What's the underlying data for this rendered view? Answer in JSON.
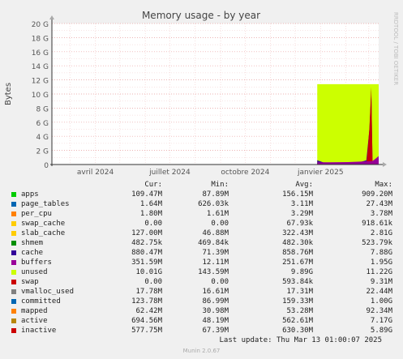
{
  "chart_data": {
    "type": "area",
    "title": "Memory usage - by year",
    "ylabel": "Bytes",
    "watermark": "RRDTOOL / TOBI OETIKER",
    "y_ticks": [
      "0",
      "2 G",
      "4 G",
      "6 G",
      "8 G",
      "10 G",
      "12 G",
      "14 G",
      "16 G",
      "18 G",
      "20 G"
    ],
    "ylim": [
      0,
      20
    ],
    "y_unit": "GB",
    "x_ticks": [
      {
        "label": "avril 2024",
        "date": "2024-04-01"
      },
      {
        "label": "juillet 2024",
        "date": "2024-07-01"
      },
      {
        "label": "octobre 2024",
        "date": "2024-10-01"
      },
      {
        "label": "janvier 2025",
        "date": "2025-01-01"
      }
    ],
    "xlim": [
      "2024-02-08",
      "2025-03-13"
    ],
    "data_start": "2024-12-28",
    "series_colors": {
      "unused": "#CCFF00",
      "apps": "#00CC00",
      "cache": "#330099",
      "swap": "#CC0000",
      "buffers": "#990099",
      "committed": "#0066B3"
    },
    "series": [
      {
        "name": "apps",
        "points": [
          [
            0.0,
            0.15
          ],
          [
            0.2,
            0.12
          ],
          [
            0.4,
            0.1
          ],
          [
            0.6,
            0.12
          ],
          [
            0.8,
            0.1
          ],
          [
            1.0,
            0.11
          ]
        ]
      },
      {
        "name": "cache",
        "points": [
          [
            0.0,
            0.6
          ],
          [
            0.1,
            0.3
          ],
          [
            0.3,
            0.25
          ],
          [
            0.5,
            0.3
          ],
          [
            0.7,
            0.35
          ],
          [
            0.8,
            0.6
          ],
          [
            0.85,
            5.0
          ],
          [
            0.88,
            10.5
          ],
          [
            0.9,
            0.5
          ],
          [
            1.0,
            0.88
          ]
        ]
      },
      {
        "name": "swap",
        "points": [
          [
            0.0,
            0.0
          ],
          [
            0.8,
            0.0
          ],
          [
            0.82,
            2.0
          ],
          [
            0.85,
            5.2
          ],
          [
            0.88,
            11.0
          ],
          [
            0.9,
            0.3
          ],
          [
            1.0,
            0.0
          ]
        ]
      },
      {
        "name": "buffers",
        "points": [
          [
            0.0,
            0.3
          ],
          [
            0.5,
            0.35
          ],
          [
            0.9,
            0.5
          ],
          [
            1.0,
            1.2
          ]
        ]
      },
      {
        "name": "unused",
        "points": [
          [
            0.0,
            11.4
          ],
          [
            1.0,
            11.4
          ]
        ]
      }
    ]
  },
  "legend_headers": {
    "cur": "Cur:",
    "min": "Min:",
    "avg": "Avg:",
    "max": "Max:"
  },
  "legend": [
    {
      "name": "apps",
      "color": "#00CC00",
      "cur": "109.47M",
      "min": "87.89M",
      "avg": "156.15M",
      "max": "909.20M"
    },
    {
      "name": "page_tables",
      "color": "#0066B3",
      "cur": "1.64M",
      "min": "626.03k",
      "avg": "3.11M",
      "max": "27.43M"
    },
    {
      "name": "per_cpu",
      "color": "#FF8000",
      "cur": "1.80M",
      "min": "1.61M",
      "avg": "3.29M",
      "max": "3.78M"
    },
    {
      "name": "swap_cache",
      "color": "#FFCC00",
      "cur": "0.00",
      "min": "0.00",
      "avg": "67.93k",
      "max": "918.61k"
    },
    {
      "name": "slab_cache",
      "color": "#FFCC00",
      "cur": "127.00M",
      "min": "46.88M",
      "avg": "322.43M",
      "max": "2.81G"
    },
    {
      "name": "shmem",
      "color": "#008F00",
      "cur": "482.75k",
      "min": "469.84k",
      "avg": "482.30k",
      "max": "523.79k"
    },
    {
      "name": "cache",
      "color": "#330099",
      "cur": "880.47M",
      "min": "71.39M",
      "avg": "858.76M",
      "max": "7.88G"
    },
    {
      "name": "buffers",
      "color": "#990099",
      "cur": "351.59M",
      "min": "12.11M",
      "avg": "251.67M",
      "max": "1.95G"
    },
    {
      "name": "unused",
      "color": "#CCFF00",
      "cur": "10.01G",
      "min": "143.59M",
      "avg": "9.89G",
      "max": "11.22G"
    },
    {
      "name": "swap",
      "color": "#CC0000",
      "cur": "0.00",
      "min": "0.00",
      "avg": "593.84k",
      "max": "9.31M"
    },
    {
      "name": "vmalloc_used",
      "color": "#808080",
      "cur": "17.78M",
      "min": "16.61M",
      "avg": "17.31M",
      "max": "22.44M"
    },
    {
      "name": "committed",
      "color": "#0066B3",
      "cur": "123.78M",
      "min": "86.99M",
      "avg": "159.33M",
      "max": "1.00G"
    },
    {
      "name": "mapped",
      "color": "#FF8000",
      "cur": "62.42M",
      "min": "30.98M",
      "avg": "53.28M",
      "max": "92.34M"
    },
    {
      "name": "active",
      "color": "#B8860B",
      "cur": "694.56M",
      "min": "48.19M",
      "avg": "562.61M",
      "max": "7.17G"
    },
    {
      "name": "inactive",
      "color": "#CC0000",
      "cur": "577.75M",
      "min": "67.39M",
      "avg": "630.30M",
      "max": "5.89G"
    }
  ],
  "last_update": "Last update: Thu Mar 13 01:00:07 2025",
  "footer": "Munin 2.0.67"
}
